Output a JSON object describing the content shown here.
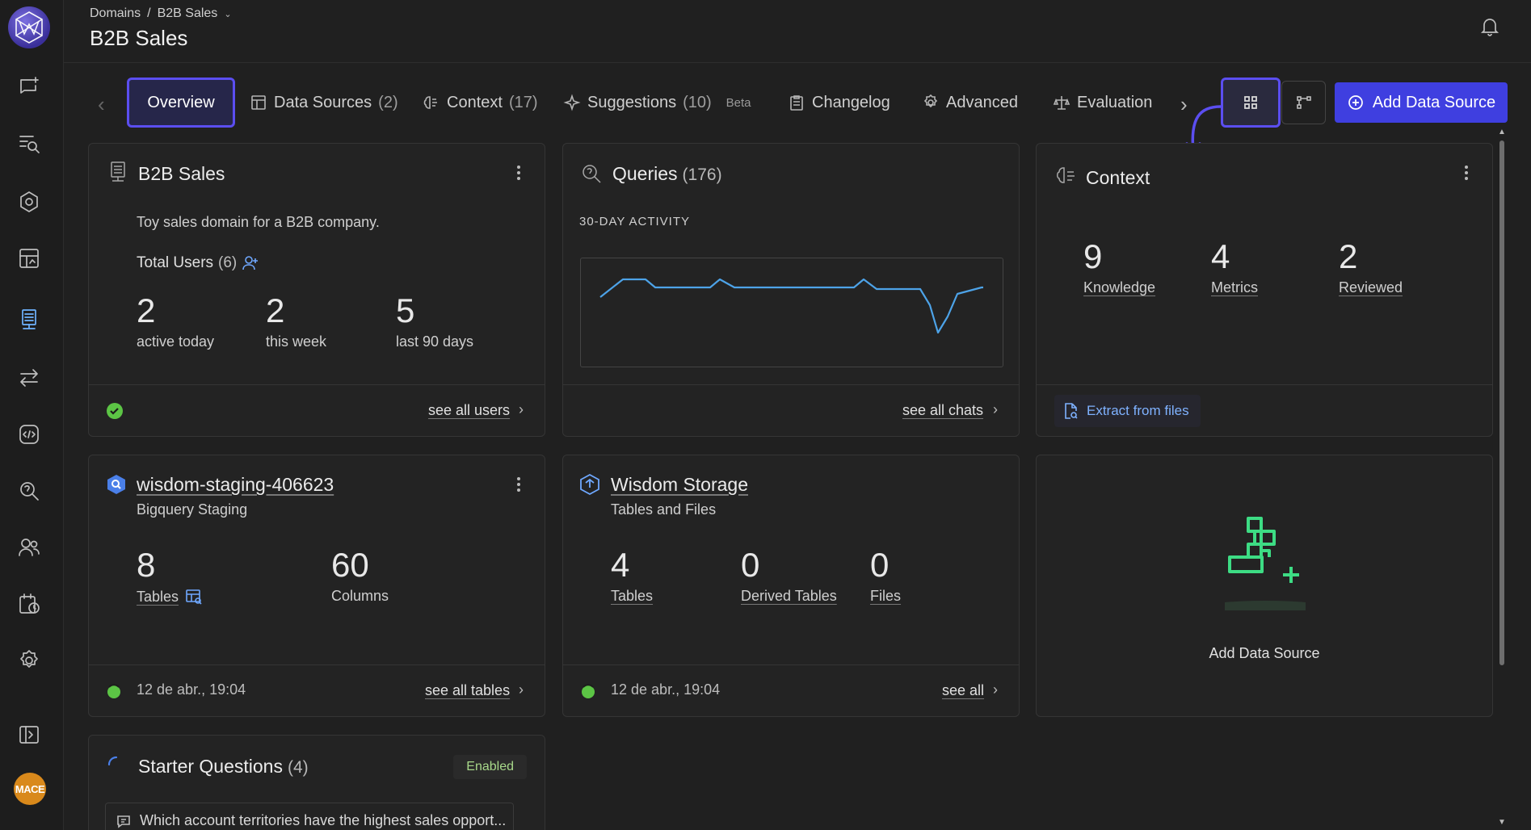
{
  "sidebar": {
    "items": [
      {
        "icon": "chat-sparkle-icon"
      },
      {
        "icon": "search-list-icon"
      },
      {
        "icon": "hexagon-network-icon"
      },
      {
        "icon": "dashboard-icon"
      },
      {
        "icon": "domain-icon",
        "active": true
      },
      {
        "icon": "transfer-icon"
      },
      {
        "icon": "code-icon"
      },
      {
        "icon": "query-search-icon"
      },
      {
        "icon": "users-icon"
      },
      {
        "icon": "schedule-icon"
      },
      {
        "icon": "gear-icon"
      },
      {
        "icon": "collapse-sidebar-icon"
      }
    ],
    "avatar_text": "MACE"
  },
  "header": {
    "breadcrumb_root": "Domains",
    "breadcrumb_sep": "/",
    "breadcrumb_current": "B2B Sales",
    "title": "B2B Sales"
  },
  "tabs": {
    "overview": "Overview",
    "data_sources": "Data Sources",
    "data_sources_count": "(2)",
    "context": "Context",
    "context_count": "(17)",
    "suggestions": "Suggestions",
    "suggestions_count": "(10)",
    "suggestions_badge": "Beta",
    "changelog": "Changelog",
    "advanced": "Advanced",
    "evaluation": "Evaluation",
    "add_data_source": "Add Data Source"
  },
  "domain_card": {
    "title": "B2B Sales",
    "description": "Toy sales domain for a B2B company.",
    "users_label": "Total Users",
    "users_count": "(6)",
    "active_today": "2",
    "active_today_label": "active today",
    "this_week": "2",
    "this_week_label": "this week",
    "last_90": "5",
    "last_90_label": "last 90 days",
    "footer_link": "see all users",
    "status": "ok"
  },
  "queries_card": {
    "title": "Queries",
    "count": "(176)",
    "subtitle": "30-DAY ACTIVITY",
    "footer_link": "see all chats",
    "line_color": "#4da3e8"
  },
  "context_card": {
    "title": "Context",
    "knowledge": "9",
    "knowledge_label": "Knowledge",
    "metrics": "4",
    "metrics_label": "Metrics",
    "reviewed": "2",
    "reviewed_label": "Reviewed",
    "extract_label": "Extract from files"
  },
  "bq_card": {
    "title": "wisdom-staging-406623",
    "subtitle": "Bigquery Staging",
    "tables": "8",
    "tables_label": "Tables",
    "columns": "60",
    "columns_label": "Columns",
    "timestamp": "12 de abr., 19:04",
    "footer_link": "see all tables"
  },
  "storage_card": {
    "title": "Wisdom Storage",
    "subtitle": "Tables and Files",
    "tables": "4",
    "tables_label": "Tables",
    "derived": "0",
    "derived_label": "Derived Tables",
    "files": "0",
    "files_label": "Files",
    "timestamp": "12 de abr., 19:04",
    "footer_link": "see all"
  },
  "add_card": {
    "label": "Add Data Source",
    "accent": "#3ddc84"
  },
  "starter_card": {
    "title": "Starter Questions",
    "count": "(4)",
    "badge": "Enabled",
    "first_question": "Which account territories have the highest sales opport..."
  }
}
